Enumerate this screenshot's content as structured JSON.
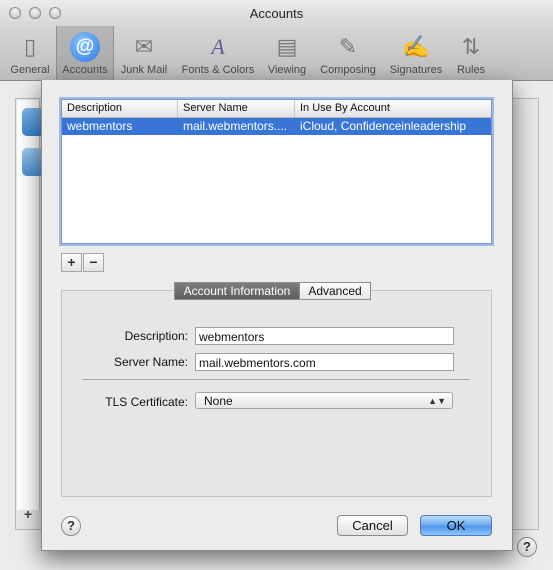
{
  "window": {
    "title": "Accounts"
  },
  "toolbar": {
    "items": [
      {
        "label": "General",
        "icon": "general-icon",
        "glyph": "▯"
      },
      {
        "label": "Accounts",
        "icon": "at-sign-icon",
        "glyph": "@"
      },
      {
        "label": "Junk Mail",
        "icon": "junk-mail-icon",
        "glyph": "✉"
      },
      {
        "label": "Fonts & Colors",
        "icon": "fonts-colors-icon",
        "glyph": "A"
      },
      {
        "label": "Viewing",
        "icon": "viewing-icon",
        "glyph": "▤"
      },
      {
        "label": "Composing",
        "icon": "composing-icon",
        "glyph": "✎"
      },
      {
        "label": "Signatures",
        "icon": "signatures-icon",
        "glyph": "✍"
      },
      {
        "label": "Rules",
        "icon": "rules-icon",
        "glyph": "⇅"
      }
    ],
    "selected": "Accounts"
  },
  "table": {
    "columns": [
      "Description",
      "Server Name",
      "In Use By Account"
    ],
    "rows": [
      {
        "description": "webmentors",
        "server": "mail.webmentors....",
        "account": "iCloud, Confidenceinleadership"
      }
    ]
  },
  "list_controls": {
    "add": "+",
    "remove": "−"
  },
  "tabs": {
    "account_information": "Account Information",
    "advanced": "Advanced"
  },
  "form": {
    "description_label": "Description:",
    "description_value": "webmentors",
    "server_label": "Server Name:",
    "server_value": "mail.webmentors.com",
    "tls_label": "TLS Certificate:",
    "tls_value": "None"
  },
  "buttons": {
    "help": "?",
    "cancel": "Cancel",
    "ok": "OK"
  },
  "background": {
    "add": "+"
  },
  "colors": {
    "selection": "#3875d7",
    "default_button": "#4c95ec"
  }
}
